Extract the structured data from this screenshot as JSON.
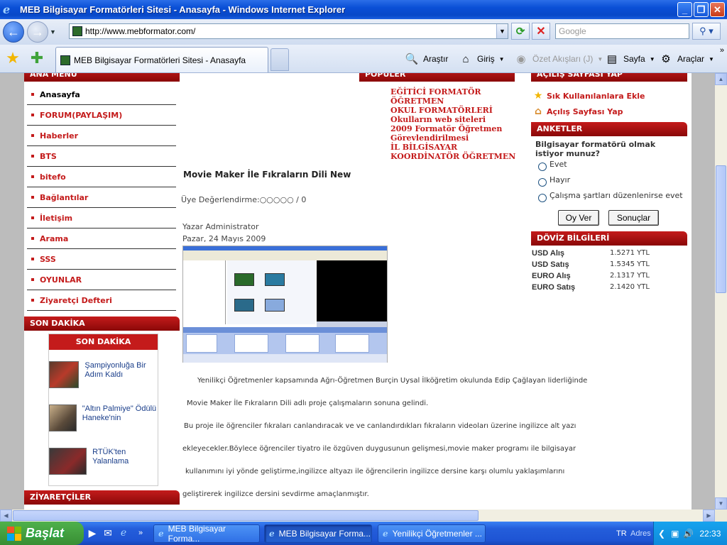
{
  "window": {
    "title": "MEB Bilgisayar Formatörleri Sitesi - Anasayfa - Windows Internet Explorer",
    "minimize": "_",
    "restore": "❐",
    "close": "✕"
  },
  "nav": {
    "url": "http://www.mebformator.com/",
    "search_placeholder": "Google"
  },
  "tabs": {
    "active_label": "MEB Bilgisayar Formatörleri Sitesi - Anasayfa"
  },
  "commands": {
    "arastir": "Araştır",
    "giris": "Giriş",
    "ozet": "Özet Akışları (J)",
    "sayfa": "Sayfa",
    "araclar": "Araçlar"
  },
  "sidebar": {
    "menu_title": "ANA MENÜ",
    "items": [
      {
        "label": "Anasayfa",
        "active": true
      },
      {
        "label": "FORUM(PAYLAŞIM)"
      },
      {
        "label": "Haberler"
      },
      {
        "label": "BTS"
      },
      {
        "label": "bitefo"
      },
      {
        "label": "Bağlantılar"
      },
      {
        "label": "İletişim"
      },
      {
        "label": "Arama"
      },
      {
        "label": "SSS"
      },
      {
        "label": "OYUNLAR"
      },
      {
        "label": "Ziyaretçi Defteri"
      }
    ],
    "son_dakika_title": "SON DAKİKA",
    "son_dakika_head": "SON DAKİKA",
    "news": [
      {
        "text": "Şampiyonluğa Bir Adım Kaldı"
      },
      {
        "text": "\"Altın Palmiye\" Ödülü Haneke'nin"
      },
      {
        "text": "RTÜK'ten Yalanlama"
      }
    ],
    "ziyaretciler_title": "ZİYARETÇİLER"
  },
  "populer": {
    "title": "POPÜLER",
    "links": [
      "EĞİTİCİ FORMATÖR ÖĞRETMEN",
      "OKUL FORMATÖRLERİ",
      "Okulların web siteleri",
      "2009 Formatör Öğretmen Görevlendirilmesi",
      "İL BİLGİSAYAR KOORDİNATÖR ÖĞRETMEN"
    ]
  },
  "right": {
    "acilis_title": "AÇILIŞ SAYFASI YAP",
    "fav_link": "Sık Kullanılanlara Ekle",
    "home_link": "Açılış Sayfası Yap",
    "anket_title": "ANKETLER",
    "anket_question": "Bilgisayar formatörü olmak istiyor munuz?",
    "options": [
      "Evet",
      "Hayır",
      "Çalışma şartları düzenlenirse evet"
    ],
    "vote_button": "Oy Ver",
    "results_button": "Sonuçlar",
    "doviz_title": "DÖVİZ BİLGİLERİ",
    "doviz": [
      {
        "k": "USD Alış",
        "v": "1.5271 YTL"
      },
      {
        "k": "USD Satış",
        "v": "1.5345 YTL"
      },
      {
        "k": "EURO Alış",
        "v": "2.1317 YTL"
      },
      {
        "k": "EURO Satış",
        "v": "2.1420 YTL"
      }
    ]
  },
  "article": {
    "title": "Movie Maker İle Fıkraların Dili New",
    "rating": "Üye Değerlendirme:○○○○○ / 0",
    "author": "Yazar Administrator",
    "date": "Pazar, 24 Mayıs 2009",
    "paragraphs": [
      "Yenilikçi Öğretmenler kapsamında Ağrı-Öğretmen Burçin Uysal İlköğretim okulunda Edip Çağlayan liderliğinde",
      "Movie Maker İle Fıkraların Dili adlı proje çalışmaların sonuna gelindi.",
      "Bu proje ile öğrenciler fıkraları canlandıracak ve ve canlandırdıkları fıkraların videoları üzerine ingilizce alt yazı",
      "ekleyecekler.Böylece öğrenciler tiyatro ile özgüven duygusunun gelişmesi,movie maker programı ile bilgisayar",
      "kullanımını iyi yönde geliştirme,ingilizce altyazı ile öğrencilerin ingilizce dersine karşı olumlu yaklaşımlarını",
      "geliştirerek ingilizce dersini sevdirme amaçlanmıştır."
    ]
  },
  "taskbar": {
    "start": "Başlat",
    "tasks": [
      "MEB Bilgisayar Forma...",
      "MEB Bilgisayar Forma...",
      "Yenilikçi Öğretmenler ..."
    ],
    "lang": "TR",
    "adres": "Adres",
    "clock": "22:33"
  }
}
